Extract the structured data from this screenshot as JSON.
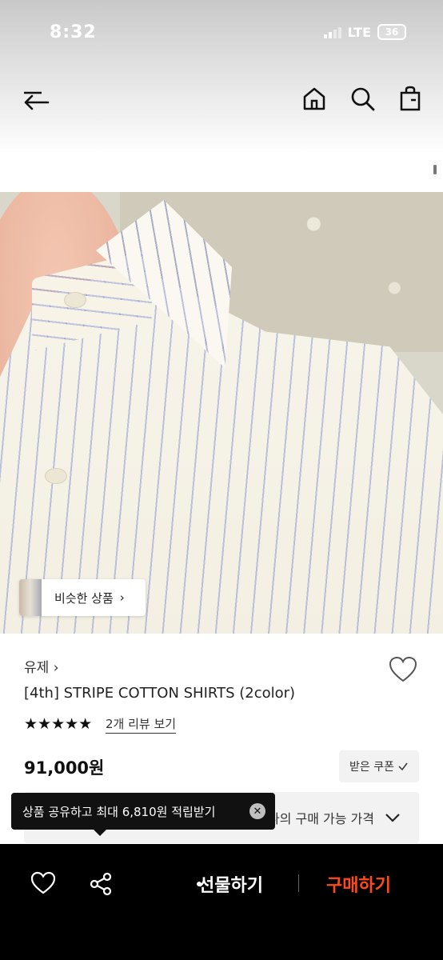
{
  "status_bar": {
    "time": "8:32",
    "network": "LTE",
    "battery": "36"
  },
  "top_nav": {
    "icons": [
      "back-arrow-icon",
      "home-icon",
      "search-icon",
      "shopping-bag-icon"
    ]
  },
  "hero": {
    "similar_products_label": "비슷한 상품",
    "similar_products_chevron": "›"
  },
  "product": {
    "brand": "유제",
    "brand_chevron": "›",
    "title": "[4th] STRIPE COTTON SHIRTS (2color)",
    "rating_stars": "★★★★★",
    "review_link": "2개 리뷰 보기",
    "price": "91,000원",
    "coupon_button": "받은 쿠폰",
    "my_price_button": "나의 구매 가능 가격"
  },
  "tooltip": {
    "text": "상품 공유하고 최대 6,810원 적립받기",
    "close_glyph": "✕"
  },
  "bottom_bar": {
    "gift_label": "선물하기",
    "buy_label": "구매하기",
    "buy_color": "#ff4a1c"
  }
}
